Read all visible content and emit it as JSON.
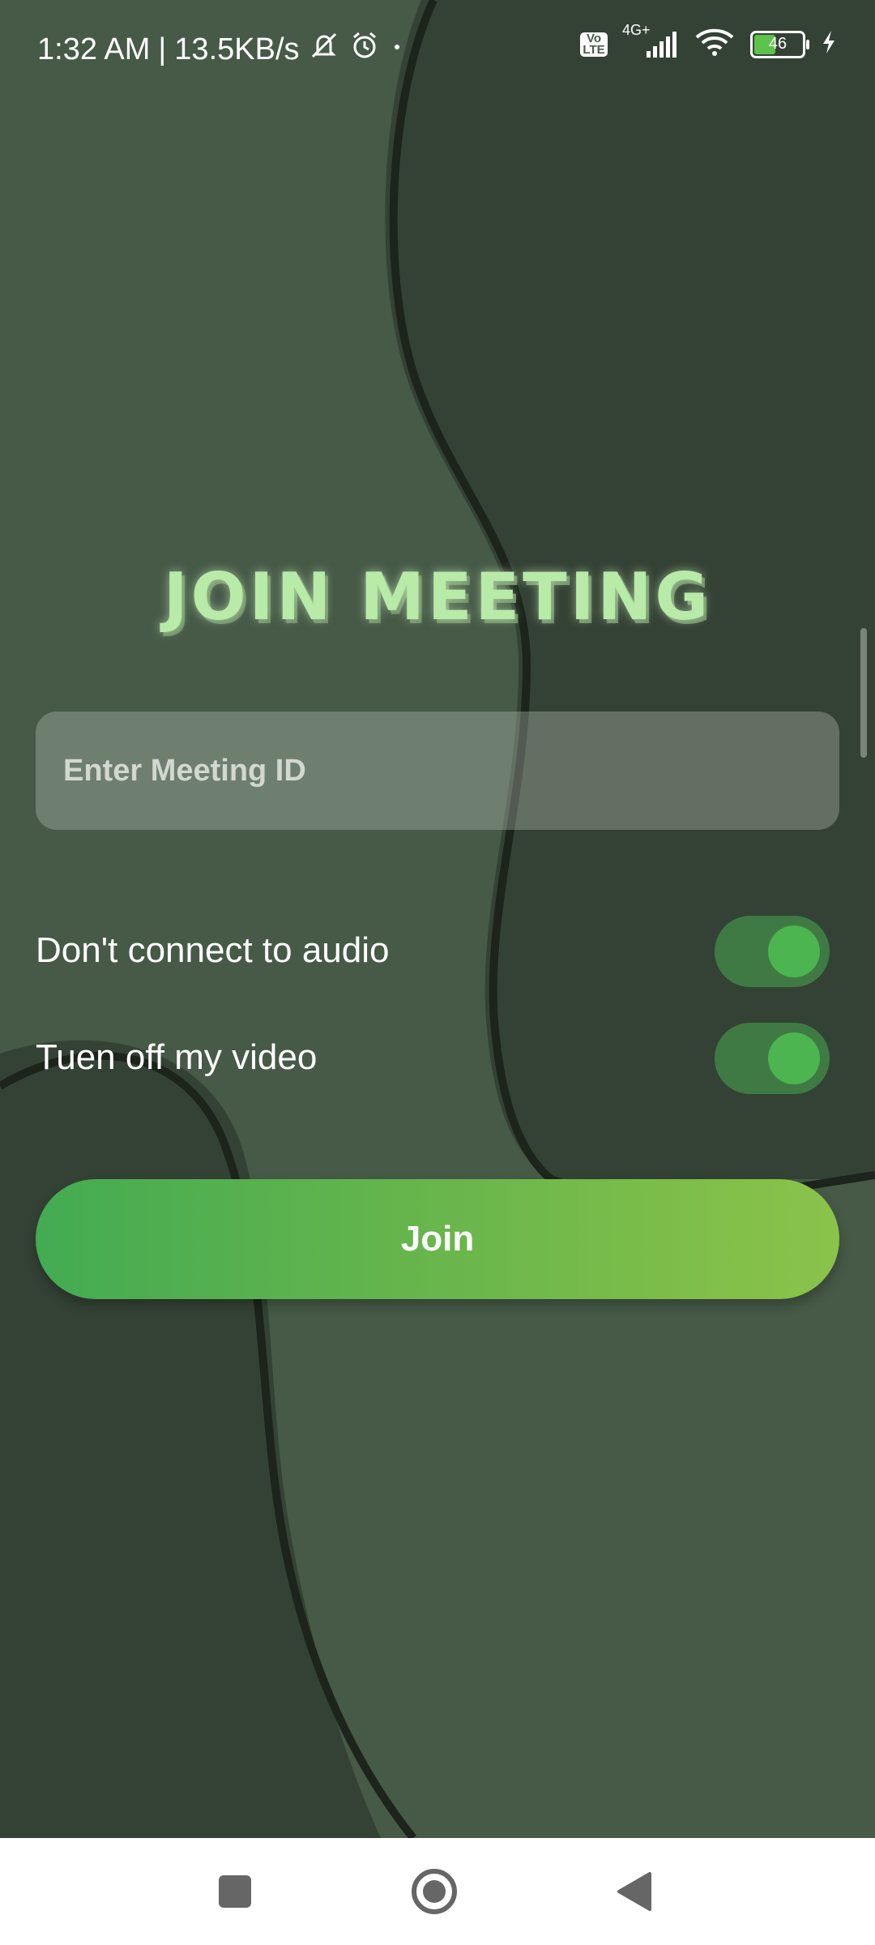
{
  "status_bar": {
    "time": "1:32 AM",
    "separator": "|",
    "net_speed": "13.5KB/s",
    "network_type": "4G+",
    "volte_line1": "Vo",
    "volte_line2": "LTE",
    "battery": "46",
    "icons": [
      "mute-icon",
      "alarm-icon",
      "volte-icon",
      "signal-icon",
      "wifi-icon",
      "battery-icon",
      "charging-icon"
    ]
  },
  "page": {
    "title": "JOIN MEETING",
    "meeting_id_placeholder": "Enter Meeting ID",
    "options": [
      {
        "label": "Don't connect to audio",
        "enabled": true
      },
      {
        "label": "Tuen off my video",
        "enabled": true
      }
    ],
    "join_label": "Join"
  },
  "navigation": {
    "icons": [
      "recents-square-icon",
      "home-circle-icon",
      "back-triangle-icon"
    ]
  },
  "colors": {
    "background": "#465a47",
    "blob_dark": "#344235",
    "title": "#b8eaa8",
    "toggle_track": "#3f7a45",
    "toggle_knob": "#4cb54f",
    "join_gradient_start": "#43ab52",
    "join_gradient_end": "#8bc34a"
  }
}
